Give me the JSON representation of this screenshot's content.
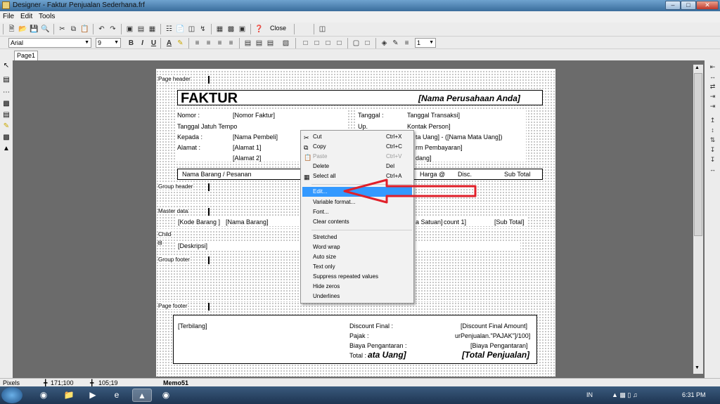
{
  "window": {
    "title": "Designer - Faktur Penjualan Sederhana.frf"
  },
  "menu": [
    "File",
    "Edit",
    "Tools"
  ],
  "toolbar": {
    "close_label": "Close",
    "font_name": "Arial",
    "font_size": "9",
    "line_width": "1"
  },
  "tabs": [
    "Page1"
  ],
  "bands": {
    "page_header": "Page header",
    "group_header": "Group header",
    "master_data": "Master data",
    "child": "Child",
    "group_footer": "Group footer",
    "page_footer": "Page footer"
  },
  "report": {
    "title": "FAKTUR",
    "company": "[Nama Perusahaan Anda]",
    "nomor_label": "Nomor :",
    "nomor_field": "[Nomor Faktur]",
    "jatuh_tempo_label": "Tanggal Jatuh Tempo",
    "kepada_label": "Kepada :",
    "nama_pembeli": "[Nama Pembeli]",
    "alamat_label": "Alamat :",
    "alamat1": "[Alamat 1]",
    "alamat2": "[Alamat 2]",
    "tanggal_label": "Tanggal :",
    "tanggal_field": "Tanggal Transaksi]",
    "up_label": "Up.",
    "kontak_field": "Kontak Person]",
    "mata_uang_field": "ta Uang] - ([Nama Mata Uang])",
    "pembayaran_field": "rm Pembayaran]",
    "gudang_field": "dang]",
    "col_nama_barang": "Nama Barang / Pesanan",
    "col_harga": "Harga @",
    "col_disc": "Disc.",
    "col_subtotal": "Sub Total",
    "row_kode": "[Kode Barang ]",
    "row_nama": "[Nama Barang]",
    "row_satuan": "a Satuan]",
    "row_count": "count 1]",
    "row_subtotal": "[Sub Total]",
    "deskripsi": "[Deskripsi]",
    "terbilang": "[Terbilang]",
    "discount_label": "Discount Final :",
    "pajak_label": "Pajak :",
    "biaya_label": "Biaya Pengantaran :",
    "total_label": "Total :",
    "total_mata_uang": "ata Uang]",
    "discount_value": "[Discount Final Amount]",
    "pajak_value": "urPenjualan.\"PAJAK\"]/100]",
    "biaya_value": "[Biaya Pengantaran]",
    "total_value": "[Total Penjualan]"
  },
  "context_menu": {
    "items": [
      {
        "label": "Cut",
        "shortcut": "Ctrl+X",
        "icon": "scissors-icon",
        "disabled": false
      },
      {
        "label": "Copy",
        "shortcut": "Ctrl+C",
        "icon": "copy-icon",
        "disabled": false
      },
      {
        "label": "Paste",
        "shortcut": "Ctrl+V",
        "icon": "paste-icon",
        "disabled": true
      },
      {
        "label": "Delete",
        "shortcut": "Del",
        "icon": "",
        "disabled": false
      },
      {
        "label": "Select all",
        "shortcut": "Ctrl+A",
        "icon": "select-all-icon",
        "disabled": false
      },
      {
        "label": "Edit...",
        "shortcut": "",
        "icon": "",
        "disabled": false,
        "highlighted": true
      },
      {
        "label": "Variable format...",
        "shortcut": "",
        "icon": "",
        "disabled": false
      },
      {
        "label": "Font...",
        "shortcut": "",
        "icon": "",
        "disabled": false
      },
      {
        "label": "Clear contents",
        "shortcut": "",
        "icon": "",
        "disabled": false
      },
      {
        "label": "Stretched",
        "shortcut": "",
        "icon": "",
        "disabled": false
      },
      {
        "label": "Word wrap",
        "shortcut": "",
        "icon": "",
        "disabled": false
      },
      {
        "label": "Auto size",
        "shortcut": "",
        "icon": "",
        "disabled": false
      },
      {
        "label": "Text only",
        "shortcut": "",
        "icon": "",
        "disabled": false
      },
      {
        "label": "Suppress repeated values",
        "shortcut": "",
        "icon": "",
        "disabled": false
      },
      {
        "label": "Hide zeros",
        "shortcut": "",
        "icon": "",
        "disabled": false
      },
      {
        "label": "Underlines",
        "shortcut": "",
        "icon": "",
        "disabled": false
      }
    ]
  },
  "status": {
    "units": "Pixels",
    "position": "171;100",
    "size": "105;19",
    "object": "Memo51"
  },
  "taskbar": {
    "language": "IN",
    "clock": "6:31 PM"
  },
  "colors": {
    "highlight": "#3399ff",
    "arrow": "#e0202a",
    "title_bar": "#4f82b3"
  }
}
